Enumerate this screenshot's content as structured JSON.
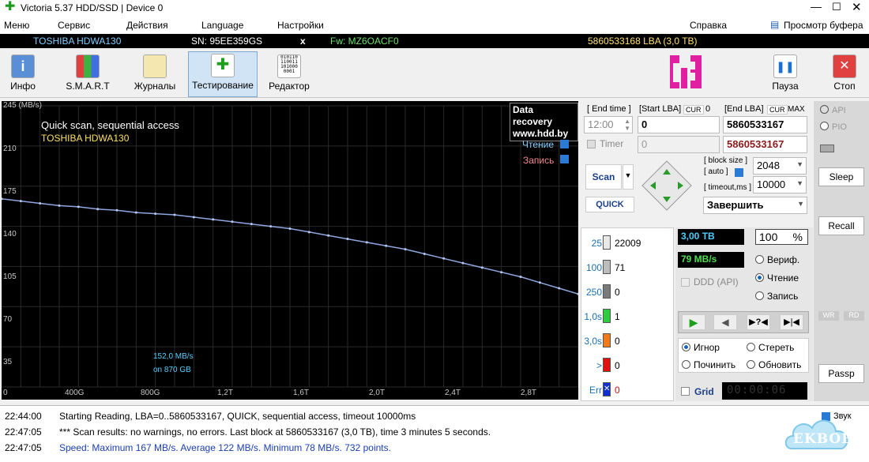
{
  "window": {
    "title": "Victoria 5.37 HDD/SSD | Device 0"
  },
  "menu": {
    "items": [
      "Меню",
      "Сервис",
      "Действия",
      "Language",
      "Настройки"
    ],
    "help": "Справка",
    "clipboard": "Просмотр буфера"
  },
  "info": {
    "model": "TOSHIBA HDWA130",
    "serial": "SN: 95EE359GS",
    "close": "x",
    "fw": "Fw: MZ6OACF0",
    "capacity": "5860533168 LBA (3,0 TB)"
  },
  "toolbar": {
    "info": "Инфо",
    "smart": "S.M.A.R.T",
    "logs": "Журналы",
    "test": "Тестирование",
    "editor": "Редактор",
    "pause": "Пауза",
    "stop": "Стоп",
    "editor_icon_text": "010110\n110011\n101000\n0001"
  },
  "graph": {
    "title": "Quick scan, sequential access",
    "model": "TOSHIBA HDWA130",
    "watermark1": "Data recovery",
    "watermark2": "www.hdd.by",
    "read_label": "Чтение",
    "write_label": "Запись",
    "tooltip1": "152,0 MB/s",
    "tooltip2": "on 870 GB",
    "y_unit_tick": "245 (MB/s)",
    "y_ticks": [
      "210",
      "175",
      "140",
      "105",
      "70",
      "35"
    ],
    "x_ticks": [
      "0",
      "400G",
      "800G",
      "1,2T",
      "1,6T",
      "2,0T",
      "2,4T",
      "2,8T"
    ]
  },
  "chart_data": {
    "type": "line",
    "title": "Quick scan, sequential access",
    "xlabel": "",
    "ylabel": "MB/s",
    "ylim": [
      0,
      245
    ],
    "xlim": [
      0,
      3000
    ],
    "series": [
      {
        "name": "Чтение",
        "x": [
          0,
          100,
          200,
          300,
          400,
          500,
          600,
          700,
          800,
          900,
          1000,
          1100,
          1200,
          1300,
          1400,
          1500,
          1600,
          1700,
          1800,
          1900,
          2000,
          2100,
          2200,
          2300,
          2400,
          2500,
          2600,
          2700,
          2800,
          2900,
          3000
        ],
        "y": [
          164,
          162,
          160,
          158,
          157,
          155,
          154,
          152,
          151,
          150,
          148,
          146,
          144,
          142,
          140,
          138,
          135,
          132,
          129,
          126,
          123,
          120,
          116,
          112,
          108,
          104,
          100,
          96,
          91,
          86,
          81
        ]
      }
    ]
  },
  "panel": {
    "end_time_label": "[ End time ]",
    "start_lba_label": "[Start LBA]",
    "cur_label": "CUR",
    "cur_value": "0",
    "end_lba_label": "[End LBA]",
    "cur2_label": "CUR",
    "max_label": "MAX",
    "time_value": "12:00",
    "start_lba": "0",
    "end_lba": "5860533167",
    "timer_label": "Timer",
    "timer_value": "0",
    "end_lba2": "5860533167",
    "scan_button": "Scan",
    "quick_button": "QUICK",
    "block_size_label": "[ block size ]",
    "auto_label": "[ auto ]",
    "timeout_label": "[ timeout,ms ]",
    "block_size": "2048",
    "timeout": "10000",
    "finish": "Завершить",
    "tb_value": "3,00 TB",
    "percent": "100",
    "percent_sign": "%",
    "speed": "79 MB/s",
    "ddd_label": "DDD (API)",
    "verify_label": "Вериф.",
    "read_label": "Чтение",
    "write_label": "Запись",
    "ignore_label": "Игнор",
    "erase_label": "Стереть",
    "repair_label": "Починить",
    "refresh_label": "Обновить",
    "grid_label": "Grid",
    "grid_time": "00:00:06",
    "step_icon_text": "?",
    "stats": [
      {
        "label": "25",
        "count": "22009",
        "color": "#e8e8e8"
      },
      {
        "label": "100",
        "count": "71",
        "color": "#bdbdbd"
      },
      {
        "label": "250",
        "count": "0",
        "color": "#7a7a7a"
      },
      {
        "label": "1,0s",
        "count": "1",
        "color": "#2ecc40"
      },
      {
        "label": "3,0s",
        "count": "0",
        "color": "#f07a1a"
      },
      {
        "label": ">",
        "count": "0",
        "color": "#e01010"
      },
      {
        "label": "Err",
        "count": "0",
        "color": "#1030d0"
      }
    ]
  },
  "side": {
    "api": "API",
    "pio": "PIO",
    "sleep": "Sleep",
    "recall": "Recall",
    "wr": "WR",
    "rd": "RD",
    "passp": "Passp",
    "sound": "Звук"
  },
  "log": [
    {
      "time": "22:44:00",
      "msg": "Starting Reading, LBA=0..5860533167, QUICK, sequential access, timeout 10000ms",
      "color": "#000000"
    },
    {
      "time": "22:47:05",
      "msg": "*** Scan results: no warnings, no errors. Last block at 5860533167 (3,0 TB), time 3 minutes 5 seconds.",
      "color": "#000000"
    },
    {
      "time": "22:47:05",
      "msg": "Speed: Maximum 167 MB/s. Average 122 MB/s. Minimum 78 MB/s. 732 points.",
      "color": "#1a3fb0"
    }
  ],
  "badge": {
    "text": "EKBOB"
  }
}
